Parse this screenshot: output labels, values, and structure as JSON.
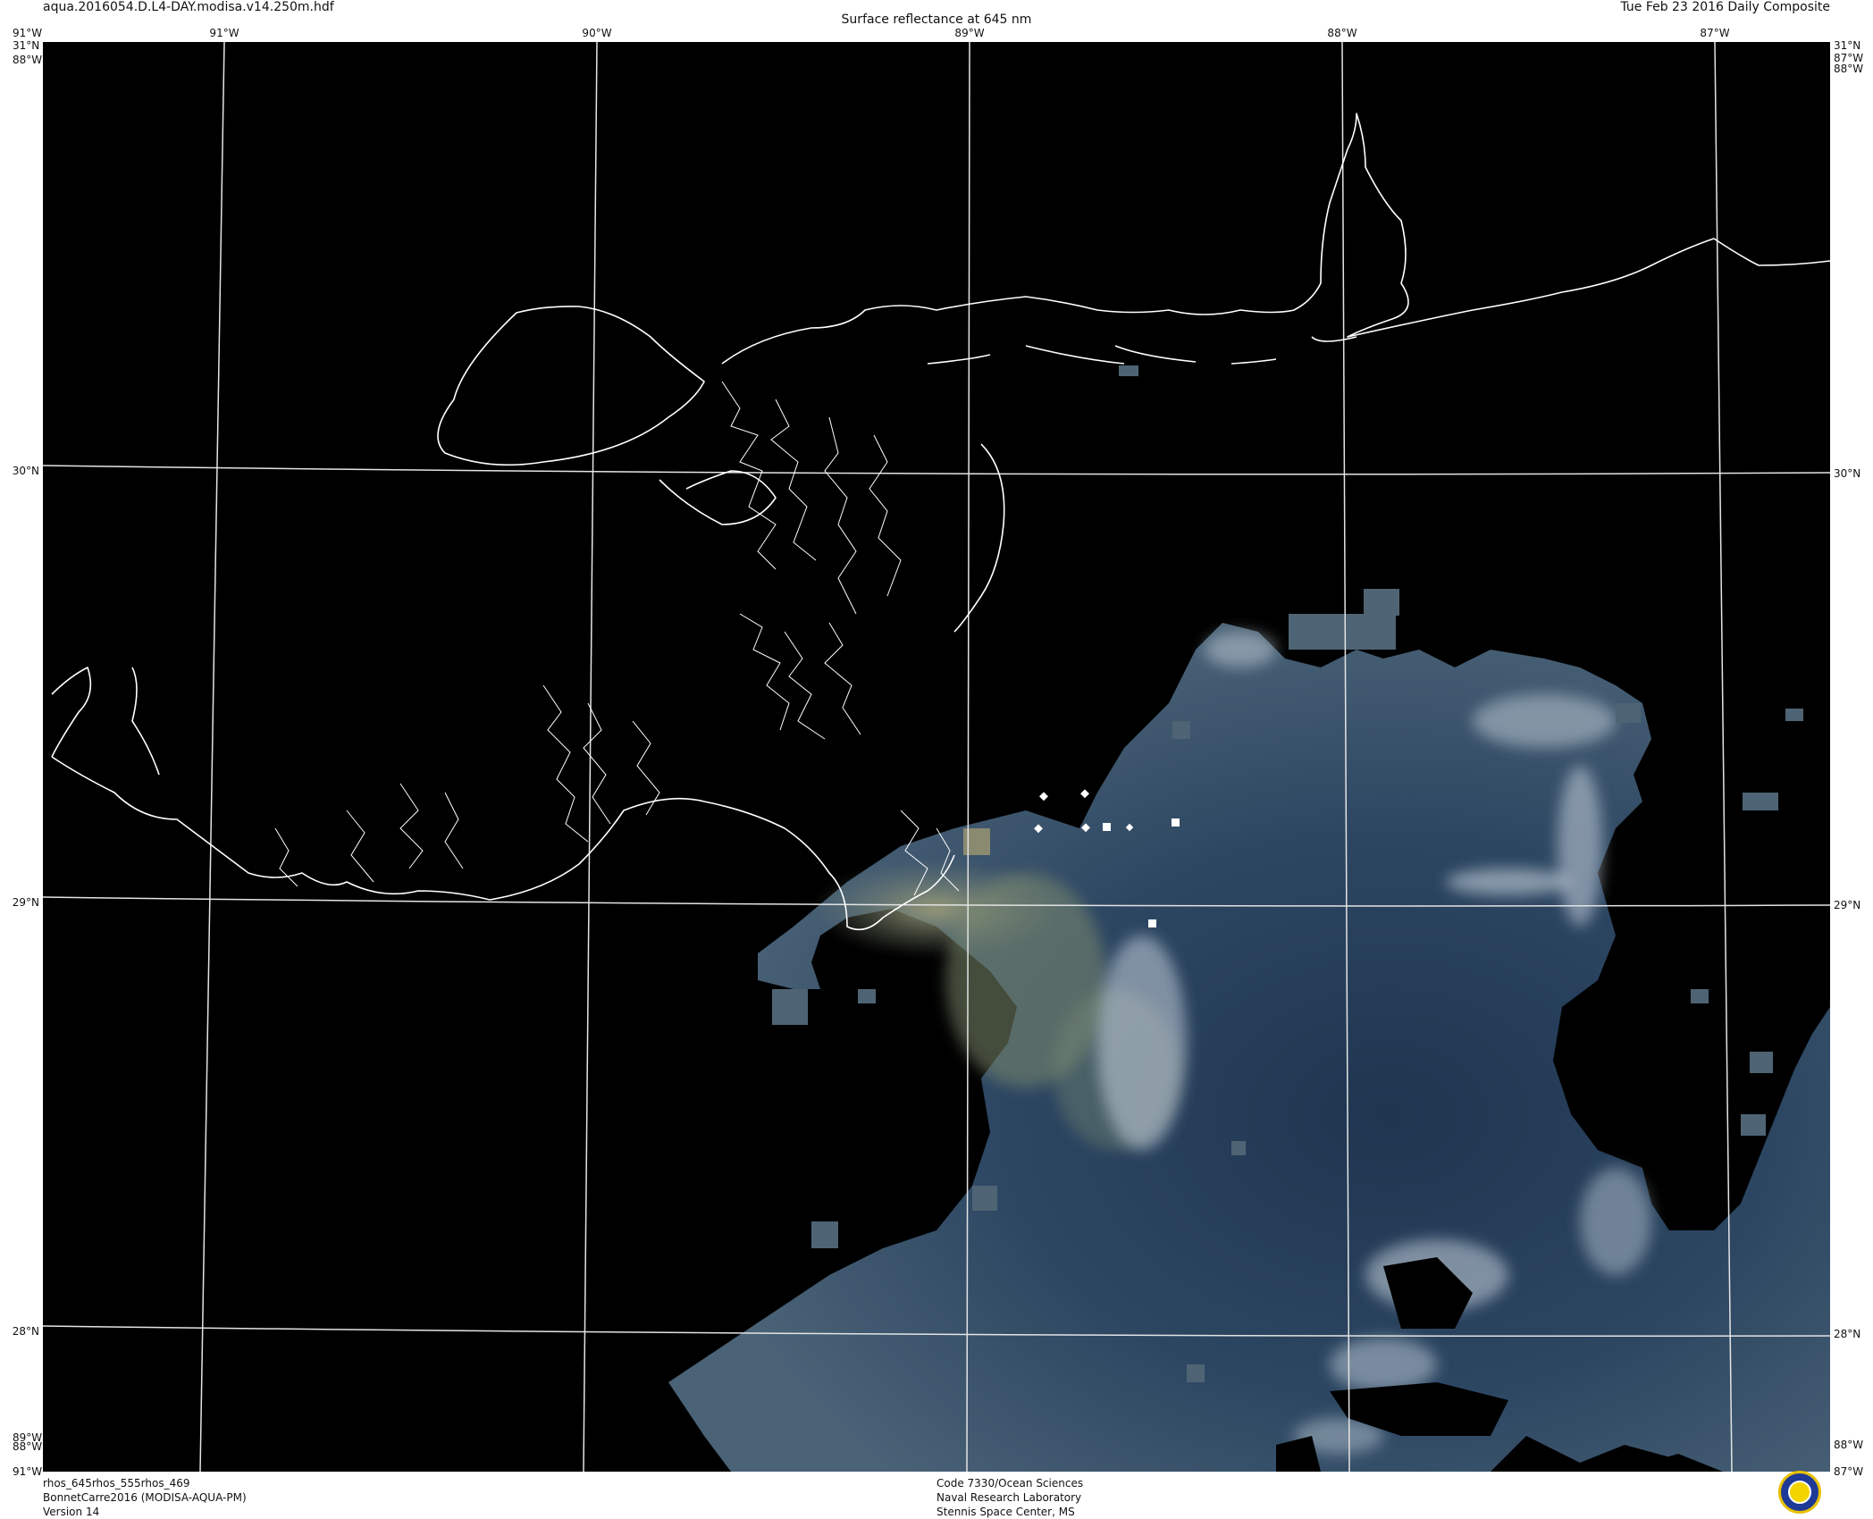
{
  "header": {
    "file_name": "aqua.2016054.D.L4-DAY.modisa.v14.250m.hdf",
    "product_title": "Surface reflectance at 645 nm",
    "date_label": "Tue Feb 23 2016 Daily Composite"
  },
  "grid": {
    "longitude_labels": [
      "91°W",
      "90°W",
      "89°W",
      "88°W",
      "87°W"
    ],
    "latitude_labels": [
      "30°N",
      "29°N",
      "28°N"
    ],
    "corner_top_left_lat": "31°N",
    "corner_top_left_lon": "91°W",
    "corner_top_left_lon_overlap": "88°W",
    "corner_top_right_lat": "31°N",
    "corner_top_right_lon": "87°W",
    "corner_top_right_lon_overlap": "88°W",
    "corner_bottom_left_lon_a": "89°W",
    "corner_bottom_left_lon_b": "88°W",
    "corner_bottom_left": "91°W",
    "corner_bottom_right_a": "88°W",
    "corner_bottom_right": "87°W"
  },
  "footer": {
    "band_combo": "rhos_645rhos_555rhos_469",
    "project": "BonnetCarre2016 (MODISA-AQUA-PM)",
    "version": "Version 14",
    "org_line1": "Code 7330/Ocean Sciences",
    "org_line2": "Naval Research Laboratory",
    "org_line3": "Stennis Space Center, MS"
  },
  "colors": {
    "land_mask": "#000000",
    "coastline": "#ffffff",
    "gridline": "#e8e8e8",
    "water_dark": "#243a58",
    "water_mid": "#3a5570",
    "plume_sediment": "#8a9070",
    "cloud": "#d0d8e0",
    "logo_blue": "#1e3a96",
    "logo_gold": "#e8c000"
  }
}
